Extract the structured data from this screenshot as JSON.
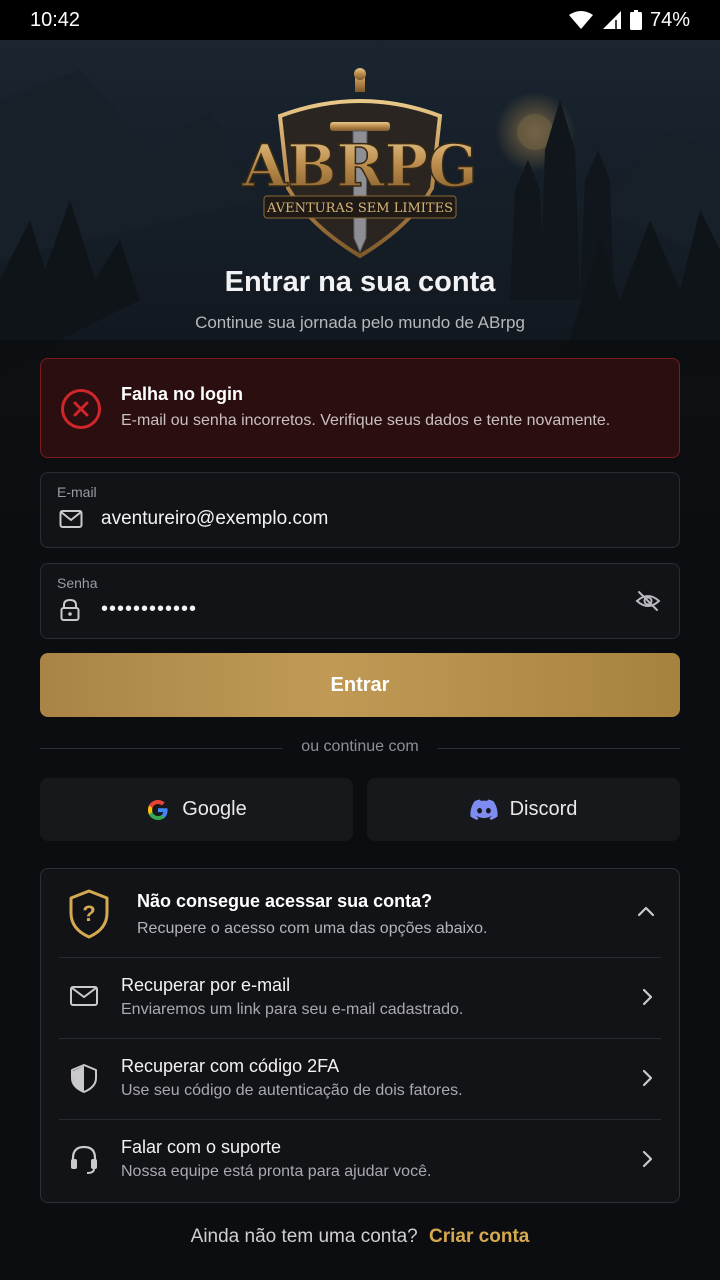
{
  "status_bar": {
    "time": "10:42",
    "battery": "74%"
  },
  "brand": {
    "logo_text": "ABRPG",
    "tagline": "AVENTURAS SEM LIMITES"
  },
  "header": {
    "title": "Entrar na sua conta",
    "subtitle": "Continue sua jornada pelo mundo de ABrpg"
  },
  "alert": {
    "title": "Falha no login",
    "message": "E-mail ou senha incorretos. Verifique seus dados e tente novamente.",
    "color": "#d0262b"
  },
  "form": {
    "email_label": "E-mail",
    "email_value": "aventureiro@exemplo.com",
    "password_label": "Senha",
    "password_mask": "••••••••••••",
    "submit_label": "Entrar"
  },
  "divider_text": "ou continue com",
  "social": {
    "google_label": "Google",
    "discord_label": "Discord"
  },
  "recovery": {
    "title": "Não consegue acessar sua conta?",
    "subtitle": "Recupere o acesso com uma das opções abaixo.",
    "options": [
      {
        "title": "Recuperar por e-mail",
        "subtitle": "Enviaremos um link para seu e-mail cadastrado.",
        "icon": "mail-icon"
      },
      {
        "title": "Recuperar com código 2FA",
        "subtitle": "Use seu código de autenticação de dois fatores.",
        "icon": "shield-icon"
      },
      {
        "title": "Falar com o suporte",
        "subtitle": "Nossa equipe está pronta para ajudar você.",
        "icon": "headset-icon"
      }
    ]
  },
  "footer": {
    "prompt": "Ainda não tem uma conta?",
    "link": "Criar conta"
  },
  "colors": {
    "accent": "#c09a55",
    "link": "#d5a94f",
    "background": "#0c0d10"
  }
}
